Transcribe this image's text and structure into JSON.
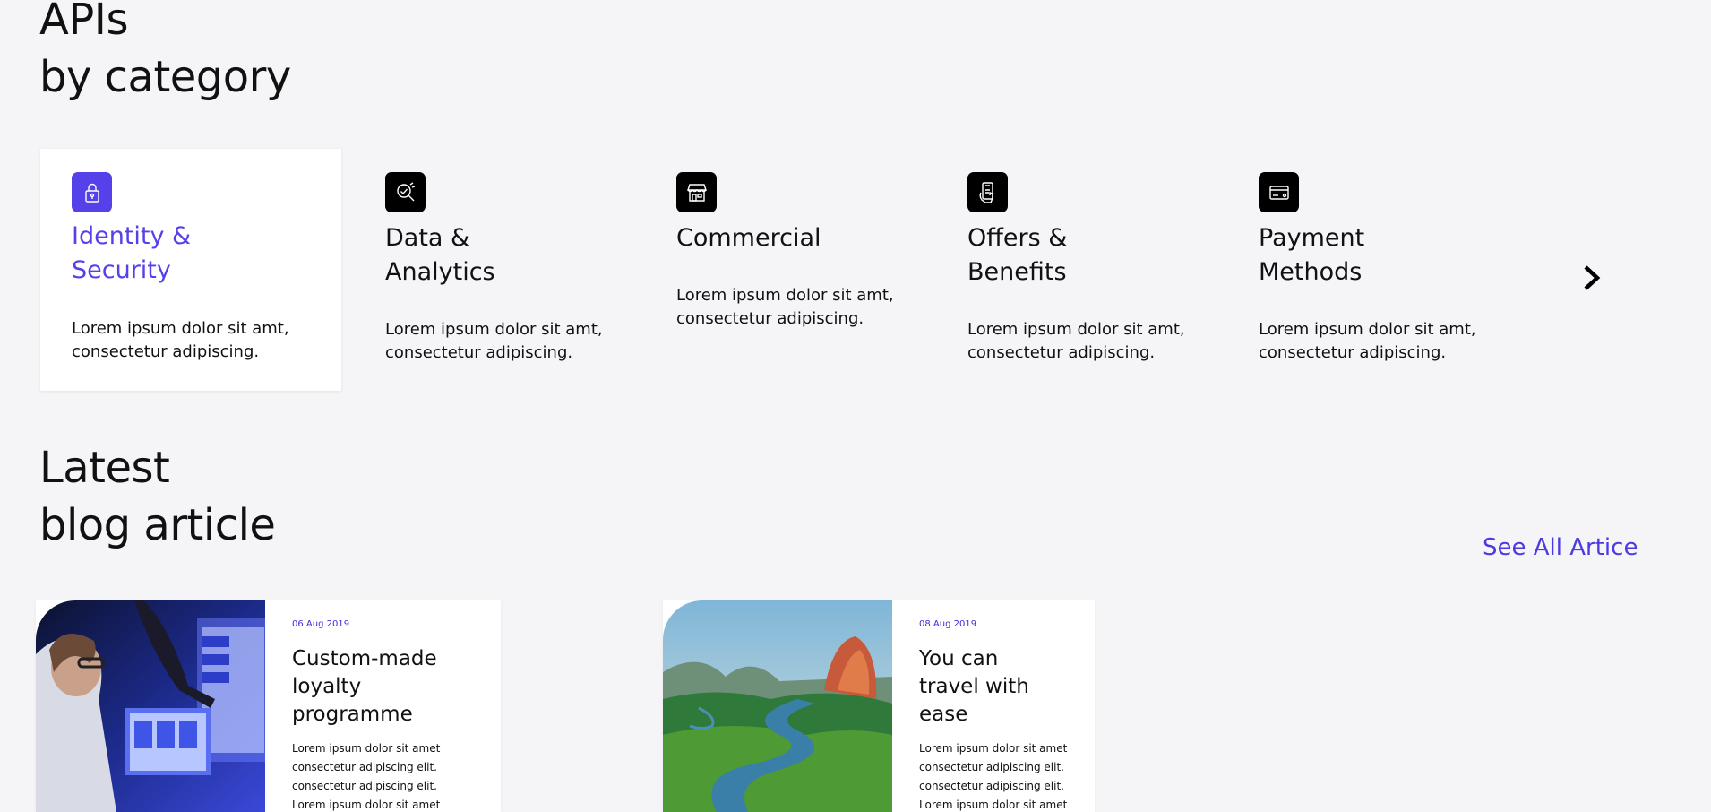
{
  "apis_section": {
    "title_line1": "APIs",
    "title_line2": "by category",
    "categories": [
      {
        "title_line1": "Identity &",
        "title_line2": "Security",
        "description_line1": "Lorem ipsum dolor sit amt,",
        "description_line2": "consectetur adipiscing.",
        "icon": "lock-icon",
        "active": true
      },
      {
        "title_line1": "Data &",
        "title_line2": "Analytics",
        "description_line1": "Lorem ipsum dolor sit amt,",
        "description_line2": "consectetur adipiscing.",
        "icon": "analytics-magnifier-icon",
        "active": false
      },
      {
        "title_line1": "Commercial",
        "title_line2": "",
        "description_line1": "Lorem ipsum dolor sit amt,",
        "description_line2": "consectetur adipiscing.",
        "icon": "storefront-icon",
        "active": false
      },
      {
        "title_line1": "Offers &",
        "title_line2": "Benefits",
        "description_line1": "Lorem ipsum dolor sit amt,",
        "description_line2": "consectetur adipiscing.",
        "icon": "phone-offer-icon",
        "active": false
      },
      {
        "title_line1": "Payment",
        "title_line2": "Methods",
        "description_line1": "Lorem ipsum dolor sit amt,",
        "description_line2": "consectetur adipiscing.",
        "icon": "credit-card-icon",
        "active": false
      }
    ],
    "next_icon": "chevron-right-icon"
  },
  "blog_section": {
    "title_line1": "Latest",
    "title_line2": "blog article",
    "see_all_label": "See All Artice",
    "articles": [
      {
        "date": "06 Aug 2019",
        "title_line1": "Custom-made",
        "title_line2": "loyalty programme",
        "excerpt": [
          "Lorem ipsum dolor sit amet",
          "consectetur adipiscing elit.",
          "consectetur adipiscing elit.",
          "Lorem ipsum dolor sit amet"
        ]
      },
      {
        "date": "08 Aug 2019",
        "title_line1": "You can",
        "title_line2": "travel with ease",
        "excerpt": [
          "Lorem ipsum dolor sit amet",
          "consectetur adipiscing elit.",
          "consectetur adipiscing elit.",
          "Lorem ipsum dolor sit amet"
        ]
      }
    ]
  },
  "colors": {
    "accent": "#5541ea",
    "link": "#4a3ae0",
    "background": "#f5f5f7"
  }
}
